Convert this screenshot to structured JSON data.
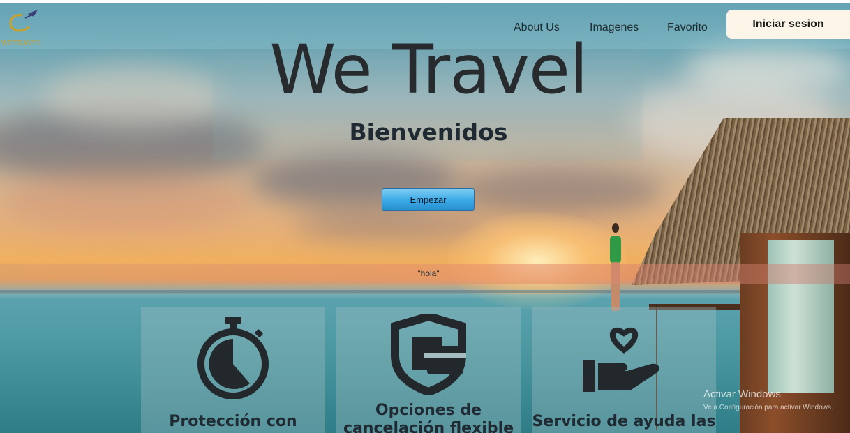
{
  "header": {
    "logo_text": "WETRAVEL",
    "nav": [
      {
        "label": "About Us"
      },
      {
        "label": "Imagenes"
      },
      {
        "label": "Favorito"
      }
    ],
    "login_label": "Iniciar sesion"
  },
  "hero": {
    "title": "We Travel",
    "subtitle": "Bienvenidos",
    "start_label": "Empezar",
    "note": "\"hola\""
  },
  "features": [
    {
      "title": "Protección con",
      "icon": "stopwatch-icon"
    },
    {
      "title": "Opciones de cancelación flexible",
      "icon": "shield-wallet-icon"
    },
    {
      "title": "Servicio de ayuda las",
      "icon": "hand-heart-icon"
    }
  ],
  "watermark": {
    "title": "Activar Windows",
    "subtitle": "Ve a Configuración para activar Windows."
  },
  "colors": {
    "button_accent": "#3aa9e6",
    "login_bg": "#fdf6e8",
    "logo_gold": "#c9a227",
    "icon_dark": "#23282c"
  }
}
